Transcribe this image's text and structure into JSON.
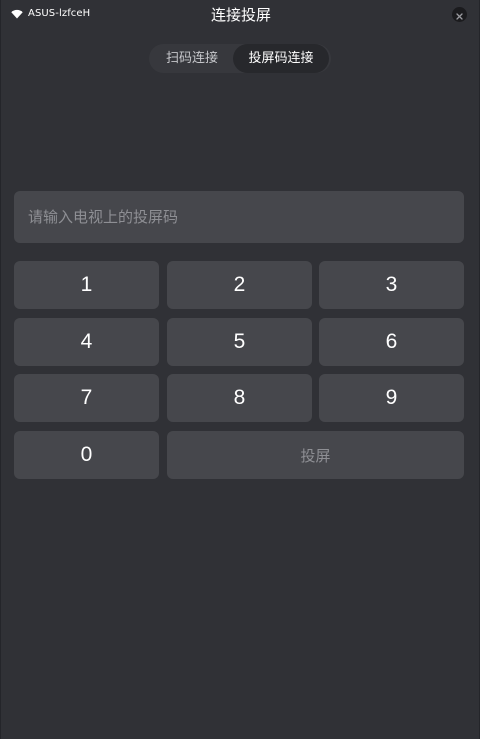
{
  "status": {
    "wifi_icon": "wifi-icon",
    "network_name": "ASUS-lzfceH"
  },
  "header": {
    "title": "连接投屏",
    "close_icon": "close-icon"
  },
  "tabs": [
    {
      "label": "扫码连接",
      "active": false
    },
    {
      "label": "投屏码连接",
      "active": true
    }
  ],
  "input": {
    "placeholder": "请输入电视上的投屏码",
    "value": ""
  },
  "keypad": {
    "keys": [
      "1",
      "2",
      "3",
      "4",
      "5",
      "6",
      "7",
      "8",
      "9",
      "0"
    ],
    "cast_label": "投屏"
  },
  "colors": {
    "background": "#303136",
    "surface": "#46474c",
    "tab_track": "#37383d",
    "tab_active": "#27282c",
    "placeholder": "#8e8f94",
    "text": "#ffffff"
  }
}
